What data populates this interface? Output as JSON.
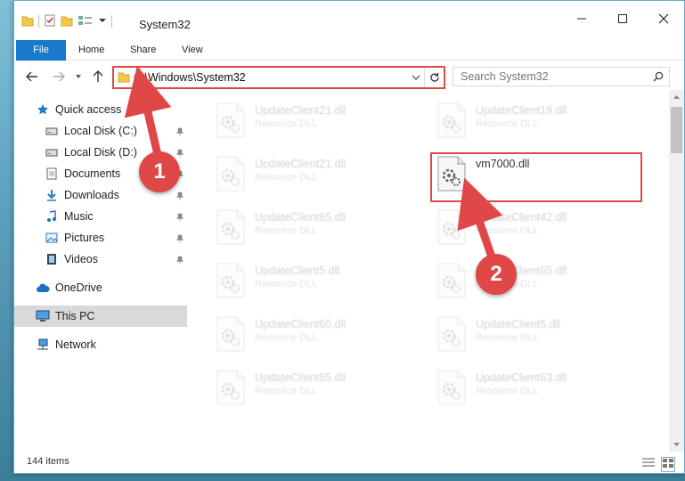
{
  "window": {
    "title": "System32"
  },
  "ribbon": {
    "tabs": [
      "File",
      "Home",
      "Share",
      "View"
    ]
  },
  "address": {
    "path": "C:\\Windows\\System32"
  },
  "search": {
    "placeholder": "Search System32"
  },
  "nav": {
    "quick_access": "Quick access",
    "items": [
      {
        "label": "Local Disk (C:)",
        "icon": "drive-icon",
        "pinned": true
      },
      {
        "label": "Local Disk (D:)",
        "icon": "drive-icon",
        "pinned": true
      },
      {
        "label": "Documents",
        "icon": "documents-icon",
        "pinned": true
      },
      {
        "label": "Downloads",
        "icon": "download-icon",
        "pinned": true
      },
      {
        "label": "Music",
        "icon": "music-icon",
        "pinned": true
      },
      {
        "label": "Pictures",
        "icon": "pictures-icon",
        "pinned": true
      },
      {
        "label": "Videos",
        "icon": "videos-icon",
        "pinned": true
      }
    ],
    "onedrive": "OneDrive",
    "thispc": "This PC",
    "network": "Network"
  },
  "files": {
    "left": [
      {
        "name": "UpdateClient21.dll",
        "type": "Resource DLL"
      },
      {
        "name": "UpdateClient21.dll",
        "type": "Resource DLL"
      },
      {
        "name": "UpdateClient65.dll",
        "type": "Resource DLL"
      },
      {
        "name": "UpdateClient5.dll",
        "type": "Resource DLL"
      },
      {
        "name": "UpdateClient65.dll",
        "type": "Resource DLL"
      },
      {
        "name": "UpdateClient65.dll",
        "type": "Resource DLL"
      }
    ],
    "right": [
      {
        "name": "UpdateClient19.dll",
        "type": "Resource DLL"
      },
      {
        "name": "vm7000.dll",
        "type": ""
      },
      {
        "name": "UpdateClient42.dll",
        "type": "Resource DLL"
      },
      {
        "name": "UpdateClient65.dll",
        "type": "Resource DLL"
      },
      {
        "name": "UpdateClient5.dll",
        "type": "Resource DLL"
      },
      {
        "name": "UpdateClient63.dll",
        "type": "Resource DLL"
      }
    ]
  },
  "status": {
    "items": "144 items"
  },
  "annotations": {
    "step1": "1",
    "step2": "2"
  },
  "colors": {
    "accent": "#1979ca",
    "highlight": "#e04848"
  }
}
